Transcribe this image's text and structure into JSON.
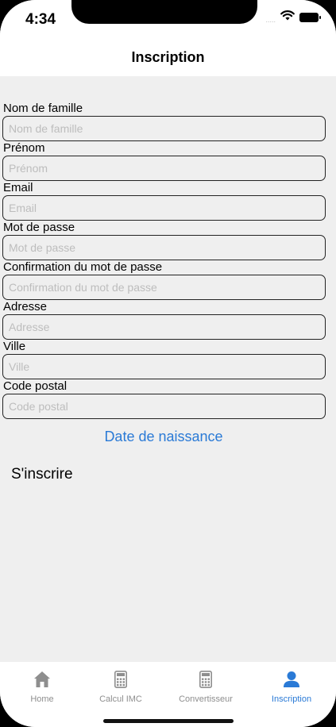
{
  "status": {
    "time": "4:34",
    "signal": "....."
  },
  "header": {
    "title": "Inscription"
  },
  "form": {
    "fields": [
      {
        "label": "Nom de famille",
        "placeholder": "Nom de famille"
      },
      {
        "label": "Prénom",
        "placeholder": "Prénom"
      },
      {
        "label": "Email",
        "placeholder": "Email"
      },
      {
        "label": "Mot de passe",
        "placeholder": "Mot de passe"
      },
      {
        "label": "Confirmation du mot de passe",
        "placeholder": "Confirmation du mot de passe"
      },
      {
        "label": "Adresse",
        "placeholder": "Adresse"
      },
      {
        "label": "Ville",
        "placeholder": "Ville"
      },
      {
        "label": "Code postal",
        "placeholder": "Code postal"
      }
    ],
    "date_label": "Date de naissance",
    "submit_label": "S'inscrire"
  },
  "tabs": [
    {
      "label": "Home",
      "icon": "home-icon",
      "active": false
    },
    {
      "label": "Calcul IMC",
      "icon": "calculator-icon",
      "active": false
    },
    {
      "label": "Convertisseur",
      "icon": "calculator-icon",
      "active": false
    },
    {
      "label": "Inscription",
      "icon": "person-icon",
      "active": true
    }
  ],
  "colors": {
    "accent": "#2a7ad6",
    "background": "#efefef",
    "inactive": "#8e8e8e"
  }
}
